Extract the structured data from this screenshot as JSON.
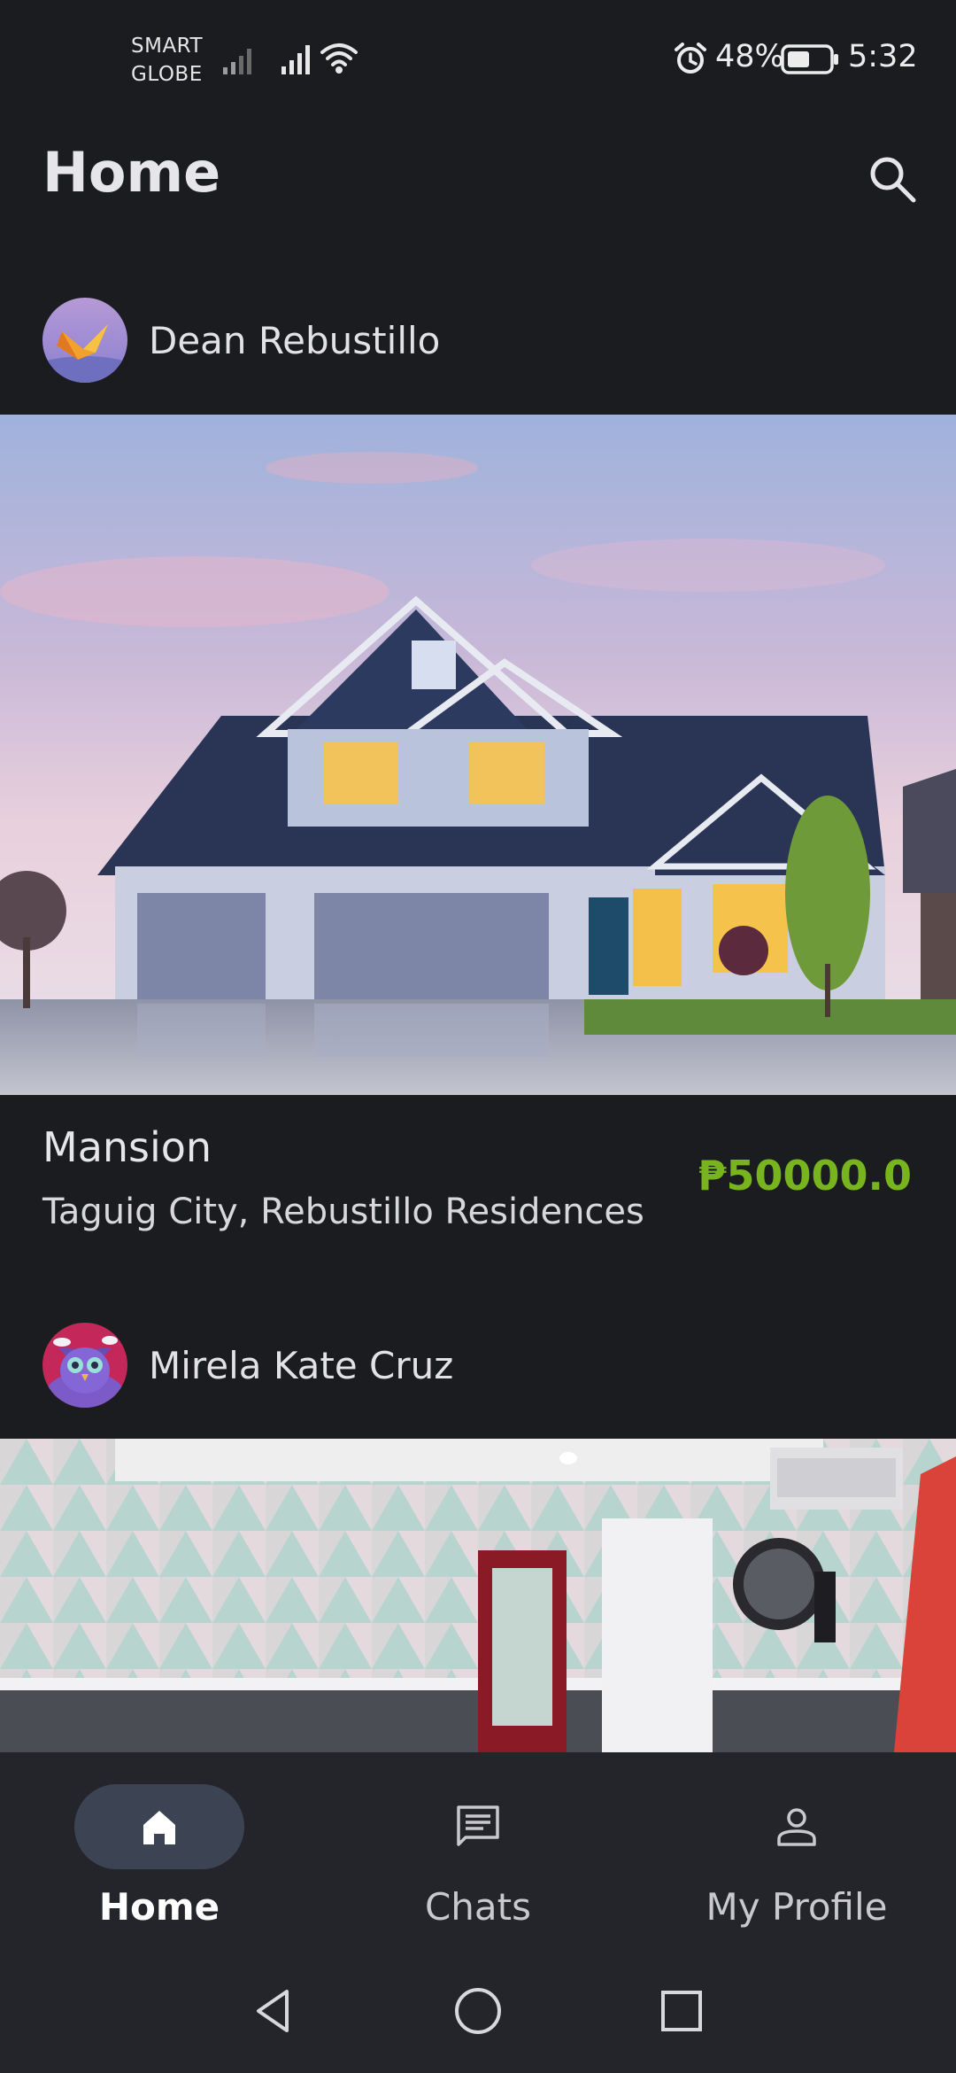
{
  "status_bar": {
    "carrier_top": "SMART",
    "carrier_bottom": "GLOBE",
    "battery_percent": "48%",
    "time": "5:32",
    "icons": [
      "signal-icon",
      "signal-icon",
      "wifi-icon",
      "alarm-icon",
      "battery-icon"
    ]
  },
  "app_bar": {
    "title": "Home",
    "search_icon": "search-icon"
  },
  "posts": [
    {
      "author": "Dean Rebustillo",
      "title": "Mansion",
      "location": "Taguig City, Rebustillo Residences",
      "price": "₱50000.0"
    },
    {
      "author": "Mirela Kate Cruz"
    }
  ],
  "bottom_nav": {
    "items": [
      {
        "label": "Home",
        "icon": "home-icon",
        "active": true
      },
      {
        "label": "Chats",
        "icon": "chat-icon",
        "active": false
      },
      {
        "label": "My Profile",
        "icon": "profile-icon",
        "active": false
      }
    ]
  },
  "colors": {
    "background": "#1b1c1f",
    "nav_background": "#23252b",
    "active_pill": "#3c4453",
    "price": "#78b41e"
  }
}
